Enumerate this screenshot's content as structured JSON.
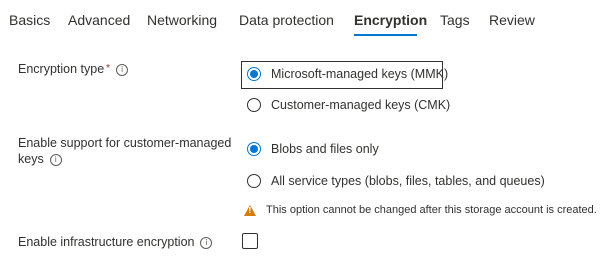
{
  "tabs": [
    {
      "label": "Basics",
      "active": false
    },
    {
      "label": "Advanced",
      "active": false
    },
    {
      "label": "Networking",
      "active": false
    },
    {
      "label": "Data protection",
      "active": false
    },
    {
      "label": "Encryption",
      "active": true
    },
    {
      "label": "Tags",
      "active": false
    },
    {
      "label": "Review",
      "active": false
    }
  ],
  "encryption_type": {
    "label": "Encryption type",
    "required_mark": "*",
    "info_icon": "info-icon",
    "options": [
      {
        "label": "Microsoft-managed keys (MMK)",
        "selected": true
      },
      {
        "label": "Customer-managed keys (CMK)",
        "selected": false
      }
    ]
  },
  "cmk_support": {
    "label_line1": "Enable support for customer-managed",
    "label_line2": "keys",
    "info_icon": "info-icon",
    "options": [
      {
        "label": "Blobs and files only",
        "selected": true
      },
      {
        "label": "All service types (blobs, files, tables, and queues)",
        "selected": false
      }
    ],
    "warning": "This option cannot be changed after this storage account is created.",
    "warning_icon": "warning-icon"
  },
  "infrastructure_encryption": {
    "label": "Enable infrastructure encryption",
    "info_icon": "info-icon",
    "checked": false
  },
  "colors": {
    "accent": "#0078d4",
    "text": "#323130",
    "required": "#a4262c",
    "warning": "#d47b0b"
  }
}
